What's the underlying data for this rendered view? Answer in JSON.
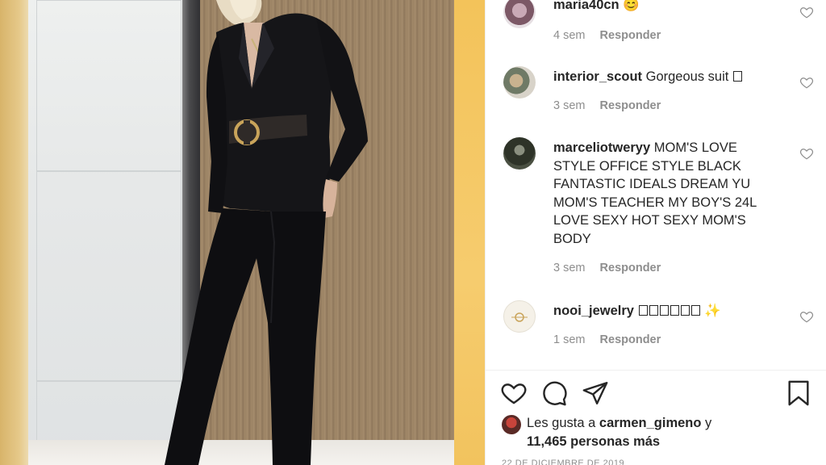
{
  "post": {
    "image_alt": "Woman in black suit with gold-buckle belt"
  },
  "comments": [
    {
      "user": "maria40cn",
      "text": "",
      "emoji": "😊",
      "time": "4 sem",
      "reply": "Responder"
    },
    {
      "user": "interior_scout",
      "text": "Gorgeous suit",
      "glyphs": 1,
      "time": "3 sem",
      "reply": "Responder"
    },
    {
      "user": "marceliotweryy",
      "text": "MOM'S LOVE STYLE OFFICE STYLE BLACK FANTASTIC IDEALS DREAM YU MOM'S TEACHER MY BOY'S 24L LOVE SEXY HOT SEXY MOM'S BODY",
      "time": "3 sem",
      "reply": "Responder"
    },
    {
      "user": "nooi_jewelry",
      "text": "",
      "glyphs": 6,
      "emoji": "✨",
      "time": "1 sem",
      "reply": "Responder"
    }
  ],
  "actions": {
    "like": "heart-icon",
    "comment": "comment-icon",
    "share": "share-icon",
    "save": "bookmark-icon"
  },
  "likes": {
    "prefix": "Les gusta a",
    "user": "carmen_gimeno",
    "suffix": "y",
    "count_text": "11,465 personas más"
  },
  "date": "22 DE DICIEMBRE DE 2019"
}
